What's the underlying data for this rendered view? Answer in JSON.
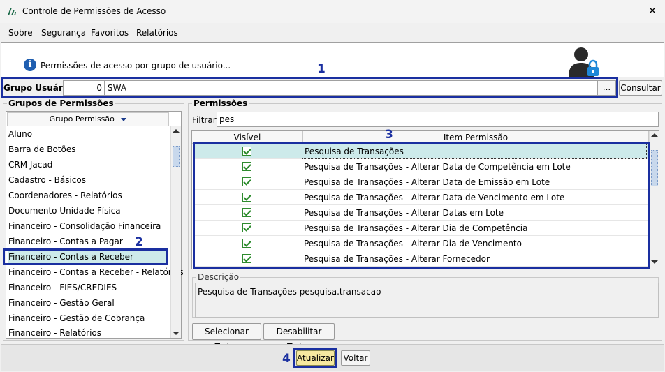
{
  "window": {
    "title": "Controle de Permissões de Acesso",
    "close_glyph": "✕"
  },
  "menu": {
    "items": [
      "Sobre",
      "Segurança",
      "Favoritos",
      "Relatórios"
    ]
  },
  "header": {
    "info_glyph": "i",
    "text": "Permissões de acesso por grupo de usuário..."
  },
  "grupo": {
    "label": "Grupo Usuário:",
    "code": "0",
    "name": "SWA",
    "ellipsis_label": "...",
    "consultar_label": "Consultar"
  },
  "annotations": {
    "n1": "1",
    "n2": "2",
    "n3": "3",
    "n4": "4"
  },
  "left_panel": {
    "title": "Grupos de Permissões",
    "column_header": "Grupo Permissão",
    "items": [
      "Aluno",
      "Barra de Botões",
      "CRM Jacad",
      "Cadastro - Básicos",
      "Coordenadores - Relatórios",
      "Documento Unidade Física",
      "Financeiro - Consolidação Financeira",
      "Financeiro - Contas a Pagar",
      "Financeiro - Contas a Receber",
      "Financeiro - Contas a Receber - Relatórios",
      "Financeiro - FIES/CREDIES",
      "Financeiro - Gestão Geral",
      "Financeiro - Gestão de Cobrança",
      "Financeiro - Relatórios"
    ],
    "selected_index": 8
  },
  "right_panel": {
    "title": "Permissões",
    "filter_label": "Filtrar:",
    "filter_value": "pes",
    "col_visible": "Visível",
    "col_item": "Item Permissão",
    "rows": [
      "Pesquisa de Transações",
      "Pesquisa de Transações - Alterar Data de Competência em Lote",
      "Pesquisa de Transações - Alterar Data de Emissão em Lote",
      "Pesquisa de Transações - Alterar Data de Vencimento em Lote",
      "Pesquisa de Transações - Alterar Datas em Lote",
      "Pesquisa de Transações - Alterar Dia de Competência",
      "Pesquisa de Transações - Alterar Dia de Vencimento",
      "Pesquisa de Transações - Alterar Fornecedor"
    ],
    "selected_row": 0,
    "description_title": "Descrição",
    "description_text": "Pesquisa de Transações pesquisa.transacao",
    "select_all_label": "Selecionar Todos",
    "disable_all_label": "Desabilitar Todos"
  },
  "footer": {
    "atualizar_label": "Atualizar",
    "voltar_label": "Voltar"
  },
  "colors": {
    "selection": "#cdeaea",
    "highlight_box": "#1a2fa0",
    "atualizar_bg": "#f6e9a0"
  }
}
